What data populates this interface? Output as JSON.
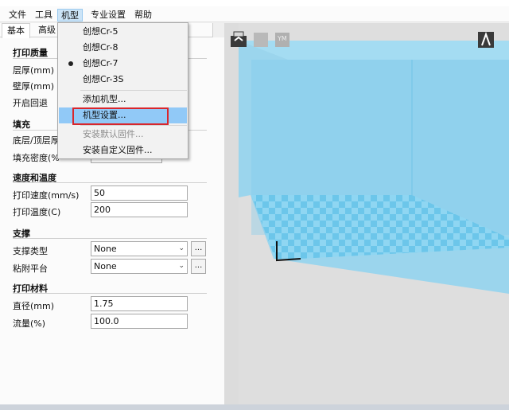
{
  "menubar": {
    "items": [
      {
        "label": "文件"
      },
      {
        "label": "工具"
      },
      {
        "label": "机型"
      },
      {
        "label": "专业设置"
      },
      {
        "label": "帮助"
      }
    ]
  },
  "tabs": [
    {
      "label": "基本"
    },
    {
      "label": "高级"
    }
  ],
  "sections": {
    "quality": {
      "title": "打印质量",
      "layer_height": "层厚(mm)",
      "wall_thickness": "壁厚(mm)",
      "retraction": "开启回退"
    },
    "fill": {
      "title": "填充",
      "bottom_top": "底层/顶层厚",
      "density": "填充密度(%"
    },
    "speed": {
      "title": "速度和温度",
      "print_speed_label": "打印速度(mm/s)",
      "print_speed_value": "50",
      "print_temp_label": "打印温度(C)",
      "print_temp_value": "200"
    },
    "support": {
      "title": "支撑",
      "support_type_label": "支撑类型",
      "support_type_value": "None",
      "adhesion_label": "粘附平台",
      "adhesion_value": "None",
      "more_btn": "..."
    },
    "material": {
      "title": "打印材料",
      "diameter_label": "直径(mm)",
      "diameter_value": "1.75",
      "flow_label": "流量(%)",
      "flow_value": "100.0"
    }
  },
  "dropdown": {
    "items": [
      {
        "label": "创想Cr-5"
      },
      {
        "label": "创想Cr-8"
      },
      {
        "label": "创想Cr-7"
      },
      {
        "label": "创想Cr-3S"
      },
      {
        "label": "添加机型..."
      },
      {
        "label": "机型设置..."
      },
      {
        "label": "安装默认固件..."
      },
      {
        "label": "安装自定义固件..."
      }
    ]
  },
  "viewport": {
    "toolbar_ym": "YM"
  },
  "colors": {
    "build_volume": "#8fd3f0",
    "bed_light": "#8fd6f2",
    "bed_dark": "#6cc6ea",
    "highlight": "#91c9f7",
    "annotation": "#d9262c"
  }
}
